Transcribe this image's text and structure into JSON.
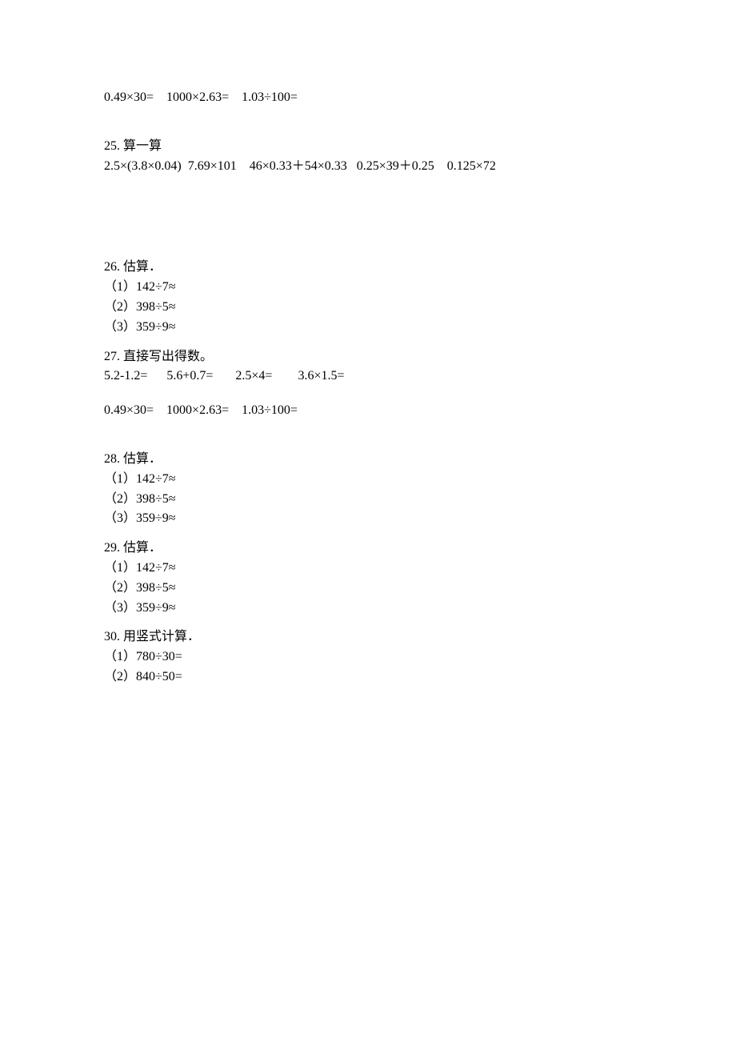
{
  "top_line": "0.49×30=    1000×2.63=    1.03÷100=",
  "q25": {
    "title": "25. 算一算",
    "content": "2.5×(3.8×0.04)  7.69×101    46×0.33＋54×0.33   0.25×39＋0.25    0.125×72"
  },
  "q26": {
    "title": "26. 估算．",
    "items": [
      "（1）142÷7≈",
      "（2）398÷5≈",
      "（3）359÷9≈"
    ]
  },
  "q27": {
    "title": "27. 直接写出得数。",
    "line1": "5.2-1.2=      5.6+0.7=       2.5×4=        3.6×1.5=",
    "line2": "0.49×30=    1000×2.63=    1.03÷100="
  },
  "q28": {
    "title": "28. 估算．",
    "items": [
      "（1）142÷7≈",
      "（2）398÷5≈",
      "（3）359÷9≈"
    ]
  },
  "q29": {
    "title": "29. 估算．",
    "items": [
      "（1）142÷7≈",
      "（2）398÷5≈",
      "（3）359÷9≈"
    ]
  },
  "q30": {
    "title": "30. 用竖式计算．",
    "items": [
      "（1）780÷30=",
      "（2）840÷50="
    ]
  }
}
